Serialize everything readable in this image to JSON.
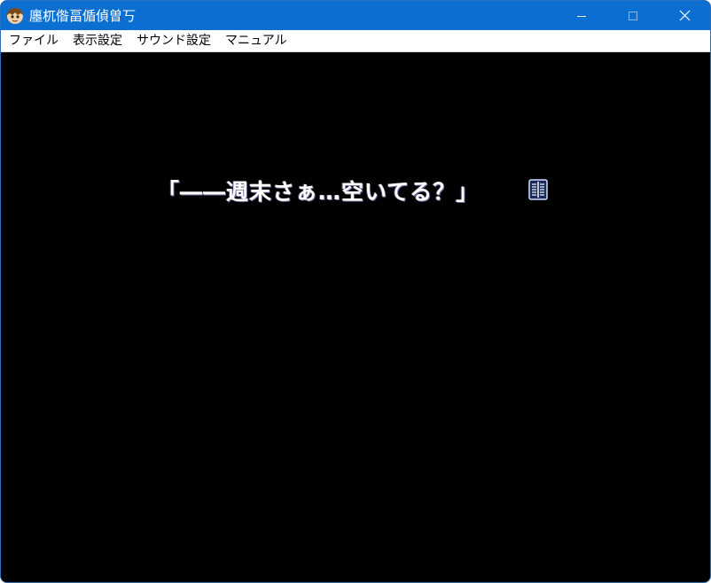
{
  "window": {
    "title": "廛杌偺畐偱偵曽丂"
  },
  "menu": {
    "items": [
      "ファイル",
      "表示設定",
      "サウンド設定",
      "マニュアル"
    ]
  },
  "game": {
    "dialogue": "「――週末さぁ…空いてる？」"
  },
  "icons": {
    "app": "app-icon",
    "minimize": "minimize-icon",
    "maximize": "maximize-icon",
    "close": "close-icon",
    "next_page": "page-wait-icon"
  },
  "colors": {
    "titlebar": "#0a6fd1",
    "game_background": "#000000",
    "dialogue_text": "#ffffff"
  }
}
